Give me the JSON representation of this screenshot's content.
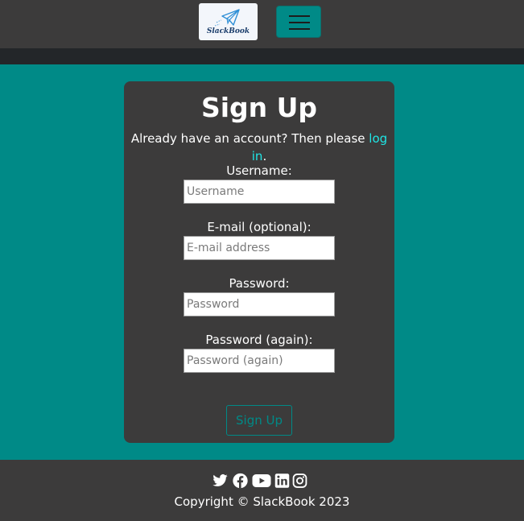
{
  "navbar": {
    "logo_text": "SlackBook",
    "logo_icon": "paper-plane-icon",
    "menu_icon": "hamburger-menu-icon"
  },
  "signup": {
    "title": "Sign Up",
    "lead_text": "Already have an account? Then please ",
    "login_link": "log in",
    "lead_end": ".",
    "username_label": "Username:",
    "username_placeholder": "Username",
    "email_label": "E-mail (optional):",
    "email_placeholder": "E-mail address",
    "password_label": "Password:",
    "password_placeholder": "Password",
    "password2_label": "Password (again):",
    "password2_placeholder": "Password (again)",
    "submit_label": "Sign Up"
  },
  "footer": {
    "social_icons": [
      "twitter-icon",
      "facebook-icon",
      "youtube-icon",
      "linkedin-icon",
      "instagram-icon"
    ],
    "copyright": "Copyright © SlackBook 2023"
  },
  "colors": {
    "teal": "#008a87",
    "dark_panel": "#3c3b3b",
    "link": "#1fe5e5"
  }
}
